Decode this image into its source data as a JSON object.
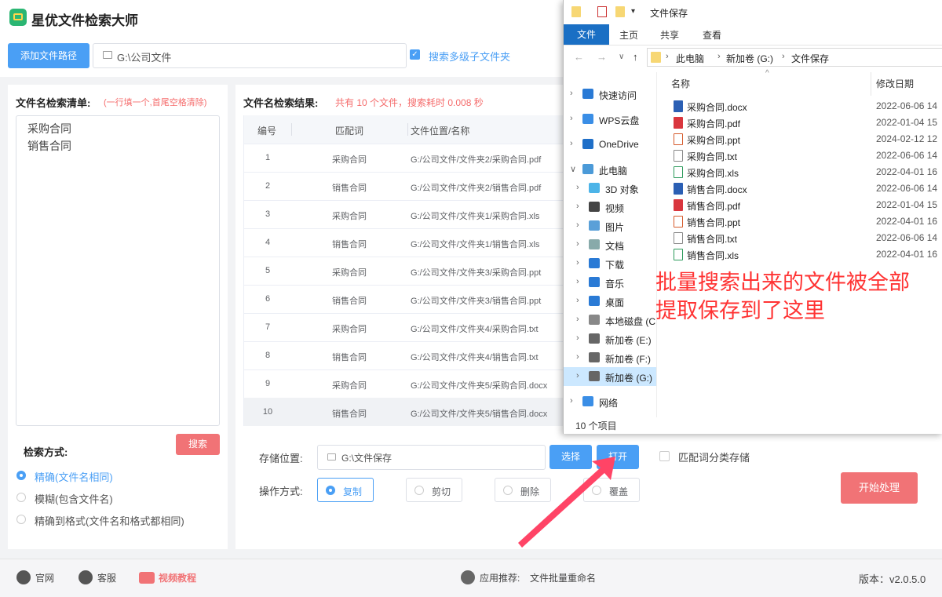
{
  "app": {
    "title": "星优文件检索大师"
  },
  "toolbar": {
    "add_path_label": "添加文件路径",
    "path_value": "G:\\公司文件",
    "subfolder_label": "搜索多级子文件夹"
  },
  "keywords": {
    "title": "文件名检索清单:",
    "hint": "(一行填一个,首尾空格清除)",
    "items": [
      "采购合同",
      "销售合同"
    ]
  },
  "search_button": "搜索",
  "search_mode": {
    "title": "检索方式:",
    "options": [
      "精确(文件名相同)",
      "模糊(包含文件名)",
      "精确到格式(文件名和格式都相同)"
    ],
    "selected": 0
  },
  "results": {
    "title": "文件名检索结果:",
    "summary": "共有 10 个文件，搜索耗时 0.008 秒",
    "headers": [
      "编号",
      "匹配词",
      "文件位置/名称"
    ],
    "rows": [
      [
        "1",
        "采购合同",
        "G:/公司文件/文件夹2/采购合同.pdf"
      ],
      [
        "2",
        "销售合同",
        "G:/公司文件/文件夹2/销售合同.pdf"
      ],
      [
        "3",
        "采购合同",
        "G:/公司文件/文件夹1/采购合同.xls"
      ],
      [
        "4",
        "销售合同",
        "G:/公司文件/文件夹1/销售合同.xls"
      ],
      [
        "5",
        "采购合同",
        "G:/公司文件/文件夹3/采购合同.ppt"
      ],
      [
        "6",
        "销售合同",
        "G:/公司文件/文件夹3/销售合同.ppt"
      ],
      [
        "7",
        "采购合同",
        "G:/公司文件/文件夹4/采购合同.txt"
      ],
      [
        "8",
        "销售合同",
        "G:/公司文件/文件夹4/销售合同.txt"
      ],
      [
        "9",
        "采购合同",
        "G:/公司文件/文件夹5/采购合同.docx"
      ],
      [
        "10",
        "销售合同",
        "G:/公司文件/文件夹5/销售合同.docx"
      ]
    ]
  },
  "storage": {
    "label": "存储位置:",
    "path": "G:\\文件保存",
    "choose_label": "选择",
    "open_label": "打开",
    "classify_label": "匹配词分类存储"
  },
  "operation": {
    "label": "操作方式:",
    "options": [
      "复制",
      "剪切",
      "删除",
      "覆盖"
    ],
    "selected": 0
  },
  "start_button": "开始处理",
  "footer": {
    "website": "官网",
    "support": "客服",
    "video": "视频教程",
    "recommend_label": "应用推荐:",
    "recommend_app": "文件批量重命名",
    "version": "版本：v2.0.5.0"
  },
  "explorer": {
    "title": "文件保存",
    "ribbon_tabs": [
      "文件",
      "主页",
      "共享",
      "查看"
    ],
    "breadcrumb": [
      "此电脑",
      "新加卷 (G:)",
      "文件保存"
    ],
    "nav_items": [
      {
        "label": "快速访问",
        "icon": "star-icon"
      },
      {
        "label": "WPS云盘",
        "icon": "cloud-icon"
      },
      {
        "label": "OneDrive",
        "icon": "onedrive-icon"
      },
      {
        "label": "此电脑",
        "icon": "computer-icon"
      },
      {
        "label": "3D 对象",
        "icon": "cube-icon"
      },
      {
        "label": "视频",
        "icon": "video-icon"
      },
      {
        "label": "图片",
        "icon": "picture-icon"
      },
      {
        "label": "文档",
        "icon": "document-icon"
      },
      {
        "label": "下载",
        "icon": "download-icon"
      },
      {
        "label": "音乐",
        "icon": "music-icon"
      },
      {
        "label": "桌面",
        "icon": "desktop-icon"
      },
      {
        "label": "本地磁盘 (C",
        "icon": "disk-icon"
      },
      {
        "label": "新加卷 (E:)",
        "icon": "drive-icon"
      },
      {
        "label": "新加卷 (F:)",
        "icon": "drive-icon"
      },
      {
        "label": "新加卷 (G:)",
        "icon": "drive-icon"
      },
      {
        "label": "网络",
        "icon": "network-icon"
      }
    ],
    "columns": {
      "name": "名称",
      "date": "修改日期"
    },
    "files": [
      {
        "name": "采购合同.docx",
        "date": "2022-06-06 14",
        "type": "docx"
      },
      {
        "name": "采购合同.pdf",
        "date": "2022-01-04 15",
        "type": "pdf"
      },
      {
        "name": "采购合同.ppt",
        "date": "2024-02-12 12",
        "type": "ppt"
      },
      {
        "name": "采购合同.txt",
        "date": "2022-06-06 14",
        "type": "txt"
      },
      {
        "name": "采购合同.xls",
        "date": "2022-04-01 16",
        "type": "xls"
      },
      {
        "name": "销售合同.docx",
        "date": "2022-06-06 14",
        "type": "docx"
      },
      {
        "name": "销售合同.pdf",
        "date": "2022-01-04 15",
        "type": "pdf"
      },
      {
        "name": "销售合同.ppt",
        "date": "2022-04-01 16",
        "type": "ppt"
      },
      {
        "name": "销售合同.txt",
        "date": "2022-06-06 14",
        "type": "txt"
      },
      {
        "name": "销售合同.xls",
        "date": "2022-04-01 16",
        "type": "xls"
      }
    ],
    "status": "10 个项目"
  },
  "annotation": {
    "line1": "批量搜索出来的文件被全部",
    "line2": "提取保存到了这里"
  },
  "colors": {
    "primary": "#4a9ff5",
    "danger": "#f17376",
    "annotation": "#ff3333"
  }
}
